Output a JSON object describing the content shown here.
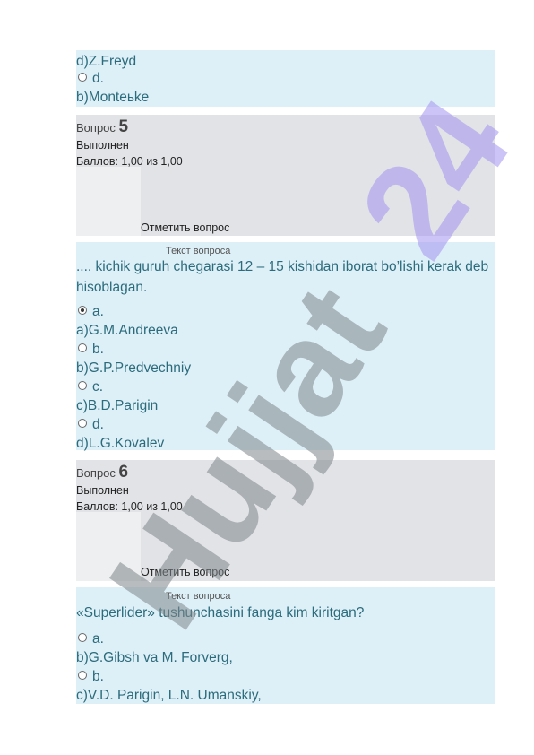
{
  "block1": {
    "lines": [
      {
        "type": "text",
        "text": "d)Z.Freyd"
      },
      {
        "type": "radio",
        "label": "d.",
        "checked": false
      },
      {
        "type": "text",
        "text": "b)Monteьke"
      }
    ]
  },
  "q5": {
    "word": "Вопрос",
    "number": "5",
    "status": "Выполнен",
    "score": "Баллов: 1,00 из 1,00",
    "flag": "Отметить вопрос",
    "text_label": "Текст вопроса",
    "text": ".... kichik guruh chegarasi 12 – 15 kishidan iborat bo’lishi kerak deb hisoblagan.",
    "options": [
      {
        "label": "a.",
        "checked": true,
        "answer": "a)G.M.Andreeva"
      },
      {
        "label": "b.",
        "checked": false,
        "answer": "b)G.P.Predvechniy"
      },
      {
        "label": "c.",
        "checked": false,
        "answer": "c)B.D.Parigin"
      },
      {
        "label": "d.",
        "checked": false,
        "answer": "d)L.G.Kovalev"
      }
    ]
  },
  "q6": {
    "word": "Вопрос",
    "number": "6",
    "status": "Выполнен",
    "score": "Баллов: 1,00 из 1,00",
    "flag": "Отметить вопрос",
    "text_label": "Текст вопроса",
    "text": "«Superlider» tushunchasini fanga kim kiritgan?",
    "options": [
      {
        "label": "a.",
        "checked": false,
        "answer": "b)G.Gibsh va M. Forverg,"
      },
      {
        "label": "b.",
        "checked": false,
        "answer": "c)V.D. Parigin, L.N. Umanskiy,"
      }
    ]
  },
  "watermark": {
    "text": "Hujjat24",
    "color_grey": "#8a9296",
    "color_purple": "#b3a6f2"
  }
}
